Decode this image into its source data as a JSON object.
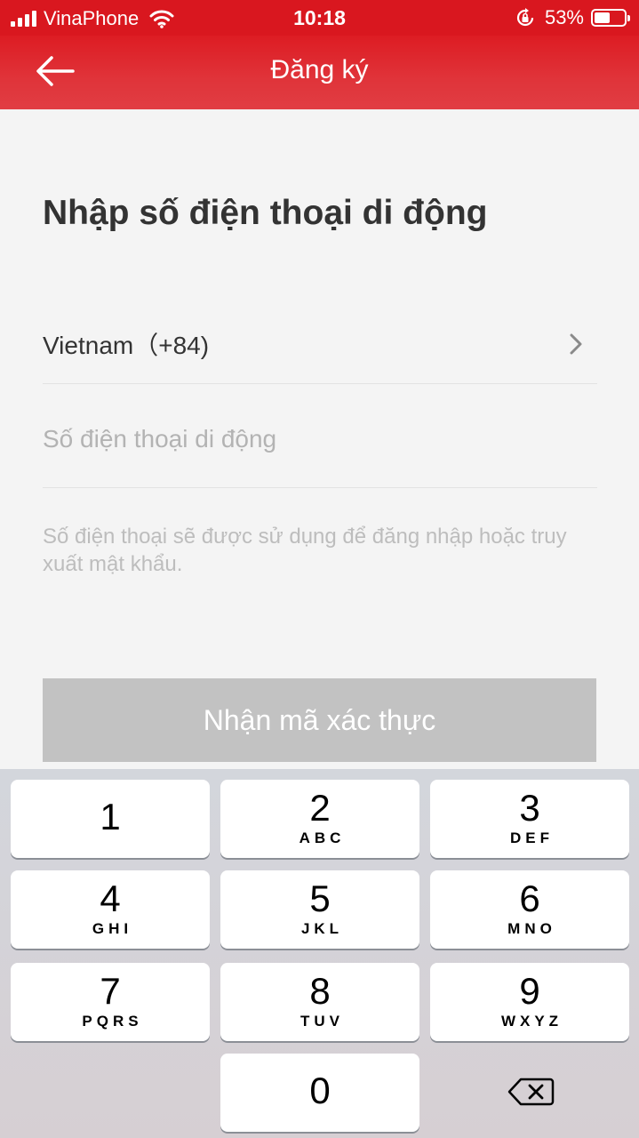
{
  "status_bar": {
    "carrier": "VinaPhone",
    "time": "10:18",
    "battery_percent": "53%",
    "battery_level": 0.53
  },
  "nav": {
    "title": "Đăng ký"
  },
  "main": {
    "heading": "Nhập số điện thoại di động",
    "country": "Vietnam（+84)",
    "phone_placeholder": "Số điện thoại di động",
    "phone_value": "",
    "hint": "Số điện thoại sẽ được sử dụng để đăng nhập hoặc truy xuất mật khẩu.",
    "submit_label": "Nhận mã xác thực"
  },
  "keypad": {
    "keys": [
      {
        "digit": "1",
        "letters": ""
      },
      {
        "digit": "2",
        "letters": "ABC"
      },
      {
        "digit": "3",
        "letters": "DEF"
      },
      {
        "digit": "4",
        "letters": "GHI"
      },
      {
        "digit": "5",
        "letters": "JKL"
      },
      {
        "digit": "6",
        "letters": "MNO"
      },
      {
        "digit": "7",
        "letters": "PQRS"
      },
      {
        "digit": "8",
        "letters": "TUV"
      },
      {
        "digit": "9",
        "letters": "WXYZ"
      },
      {
        "digit": "0",
        "letters": ""
      }
    ]
  },
  "colors": {
    "brand_red": "#d9171f",
    "disabled_button": "#c2c2c2",
    "caret": "#6c7bd8"
  },
  "icons": {
    "back": "arrow-left-icon",
    "chevron": "chevron-right-icon",
    "delete": "backspace-icon",
    "wifi": "wifi-icon",
    "rotation_lock": "rotation-lock-icon"
  }
}
